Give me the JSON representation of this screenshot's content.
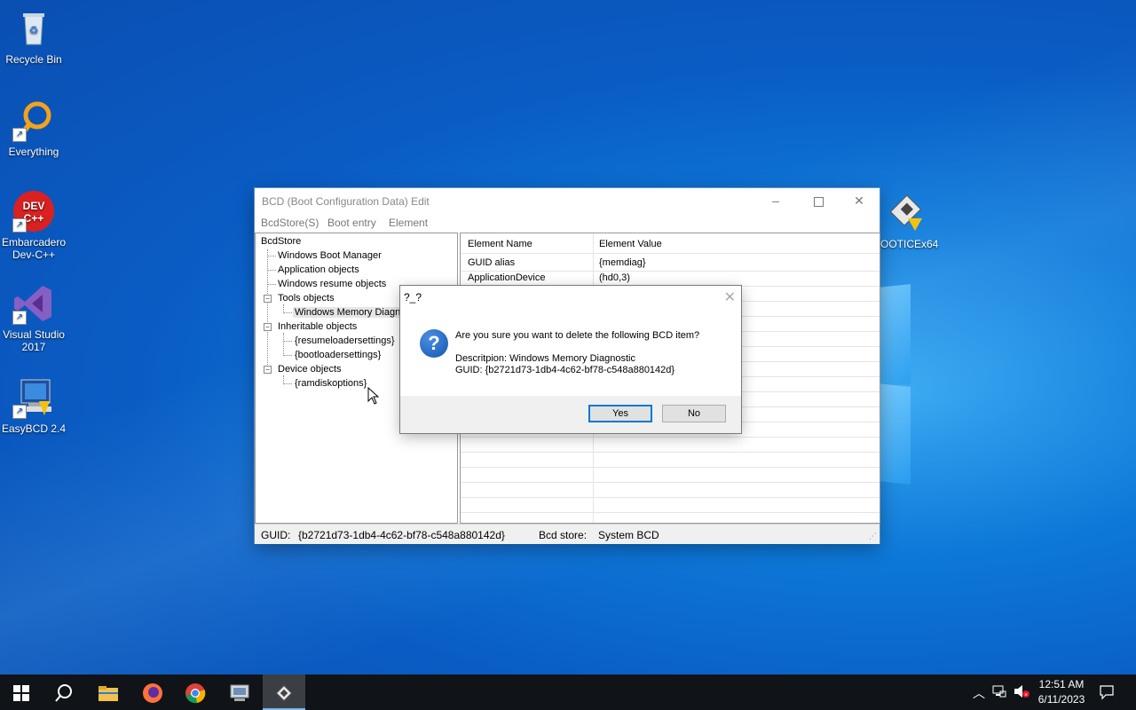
{
  "desktop": {
    "icons": [
      {
        "label": "Recycle Bin",
        "icon": "recycle-bin-icon"
      },
      {
        "label": "Everything",
        "icon": "everything-search-icon"
      },
      {
        "label": "Embarcadero Dev-C++",
        "icon": "dev-cpp-icon",
        "badge": "DEV C++"
      },
      {
        "label": "Visual Studio 2017",
        "icon": "visual-studio-icon"
      },
      {
        "label": "EasyBCD 2.4",
        "icon": "easybcd-icon"
      },
      {
        "label": "BOOTICEx64",
        "icon": "bootice-icon"
      }
    ]
  },
  "window": {
    "title": "BCD (Boot Configuration Data) Edit",
    "menu": [
      "BcdStore(S)",
      "Boot entry",
      "Element"
    ],
    "tree": {
      "root": "BcdStore",
      "items": [
        "Windows Boot Manager",
        "Application objects",
        "Windows resume objects",
        "Tools objects",
        "Windows Memory Diagno",
        "Inheritable objects",
        "{resumeloadersettings}",
        "{bootloadersettings}",
        "Device objects",
        "{ramdiskoptions}"
      ]
    },
    "grid": {
      "headers": [
        "Element Name",
        "Element Value"
      ],
      "rows": [
        {
          "name": "GUID alias",
          "value": "{memdiag}"
        },
        {
          "name": "ApplicationDevice",
          "value": "(hd0,3)"
        }
      ]
    },
    "status": {
      "guid_label": "GUID:",
      "guid_value": "{b2721d73-1db4-4c62-bf78-c548a880142d}",
      "store_label": "Bcd store:",
      "store_value": "System BCD"
    }
  },
  "dialog": {
    "title": "?_?",
    "message": "Are you sure you want to delete the following BCD item?",
    "description": "Descritpion: Windows Memory Diagnostic",
    "guid": "GUID: {b2721d73-1db4-4c62-bf78-c548a880142d}",
    "yes_label": "Yes",
    "no_label": "No"
  },
  "taskbar": {
    "apps": [
      "start-icon",
      "search-icon",
      "file-explorer-icon",
      "firefox-icon",
      "chrome-icon",
      "pc-app-icon",
      "bootice-app-icon"
    ],
    "time": "12:51 AM",
    "date": "6/11/2023"
  },
  "colors": {
    "accent": "#0078d7",
    "desktop": "#0a5cc4",
    "taskbar": "#101418"
  }
}
